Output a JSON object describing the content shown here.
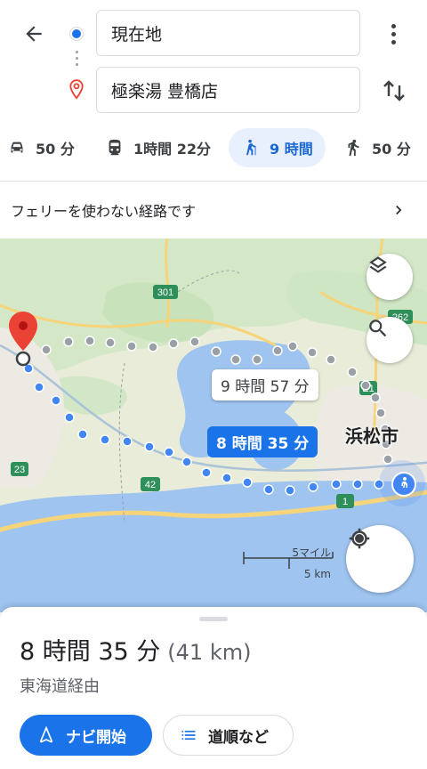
{
  "search": {
    "origin": "現在地",
    "destination": "極楽湯 豊橋店"
  },
  "modes": [
    {
      "icon": "car-icon",
      "label": "50 分"
    },
    {
      "icon": "train-icon",
      "label": "1時間 22分"
    },
    {
      "icon": "hiking-icon",
      "label": "9 時間",
      "active": true
    },
    {
      "icon": "walking-icon",
      "label": "50 分"
    }
  ],
  "notice": "フェリーを使わない経路です",
  "map": {
    "callout_alt": "9 時間 57 分",
    "callout_main": "8 時間 35 分",
    "city": "浜松市",
    "road_labels": [
      "301",
      "262",
      "E1",
      "23",
      "42",
      "1"
    ],
    "scale_mi": "5マイル",
    "scale_km": "5 km",
    "colors": {
      "route": "#4285f4",
      "alt_route": "#9aa0a6",
      "water": "#9fc4f0",
      "land": "#e9ecd8",
      "park": "#cfe6c4"
    }
  },
  "summary": {
    "duration": "8 時間 35 分",
    "distance": "(41 km)",
    "via": "東海道経由"
  },
  "buttons": {
    "start": "ナビ開始",
    "steps": "道順など"
  }
}
